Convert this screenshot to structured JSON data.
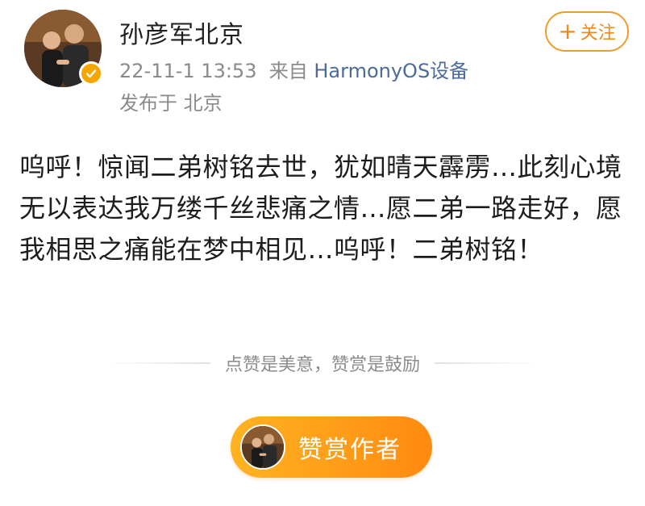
{
  "header": {
    "username": "孙彦军北京",
    "timestamp": "22-11-1 13:53",
    "source_prefix": "来自",
    "device": "HarmonyOS设备",
    "location": "发布于 北京",
    "follow_label": "关注",
    "follow_icon": "+",
    "verified_icon": "verified-badge-icon",
    "accent_color": "#f39b28"
  },
  "post": {
    "text": "呜呼！惊闻二弟树铭去世，犹如晴天霹雳…此刻心境无以表达我万缕千丝悲痛之情…愿二弟一路走好，愿我相思之痛能在梦中相见…呜呼！二弟树铭！"
  },
  "reward": {
    "hint": "点赞是美意，赞赏是鼓励",
    "button_label": "赞赏作者"
  }
}
